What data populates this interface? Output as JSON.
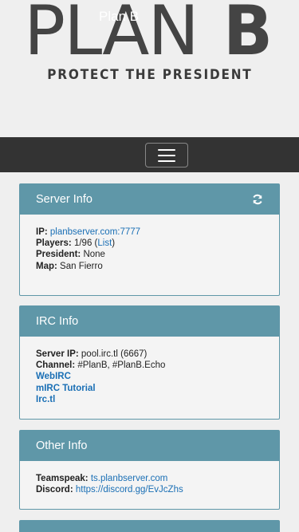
{
  "logo": {
    "plan_text": "PLAN",
    "b_text": "B",
    "tagline": "PROTECT THE PRESIDENT"
  },
  "navbar": {
    "brand": "Plan B",
    "toggle_icon": "hamburger-icon"
  },
  "server_info": {
    "title": "Server Info",
    "refresh_icon": "refresh-icon",
    "ip_label": "IP:",
    "ip_value": "planbserver.com:7777",
    "players_label": "Players:",
    "players_value": "1/96 (",
    "players_link": "List",
    "players_close": ")",
    "president_label": "President:",
    "president_value": "None",
    "map_label": "Map:",
    "map_value": "San Fierro"
  },
  "irc_info": {
    "title": "IRC Info",
    "server_ip_label": "Server IP:",
    "server_ip_value": "pool.irc.tl (6667)",
    "channel_label": "Channel:",
    "channel_value": "#PlanB, #PlanB.Echo",
    "links": [
      "WebIRC",
      "mIRC Tutorial",
      "Irc.tl"
    ]
  },
  "other_info": {
    "title": "Other Info",
    "teamspeak_label": "Teamspeak:",
    "teamspeak_value": "ts.planbserver.com",
    "discord_label": "Discord:",
    "discord_value": "https://discord.gg/EvJcZhs"
  },
  "colors": {
    "panel_accent": "#5f97a8",
    "navbar_bg": "#333333",
    "link": "#1a6fb5",
    "page_bg": "#efefef"
  }
}
